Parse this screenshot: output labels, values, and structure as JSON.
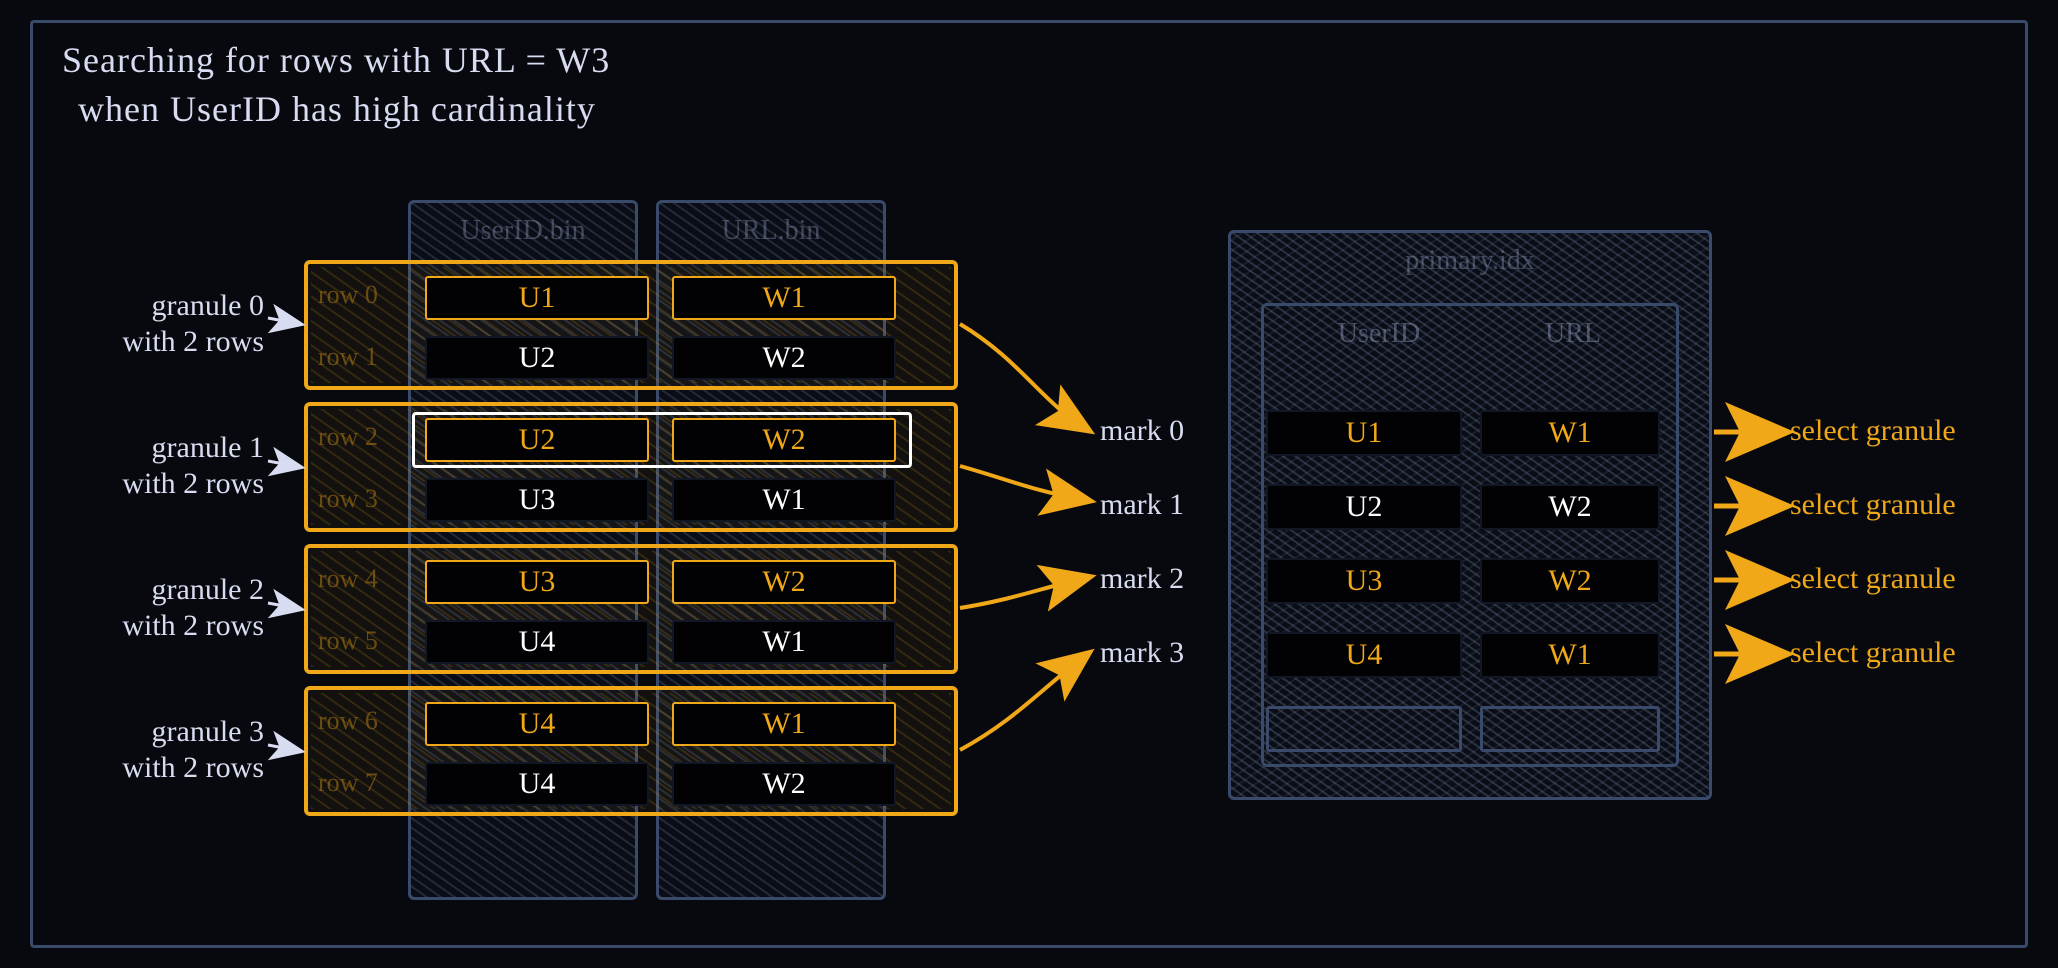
{
  "title_l1": "Searching for rows with URL = W3",
  "title_l2": "when UserID has high cardinality",
  "colfiles": {
    "userid": "UserID.bin",
    "url": "URL.bin"
  },
  "granuleLabels": [
    {
      "l1": "granule 0",
      "l2": "with 2 rows"
    },
    {
      "l1": "granule 1",
      "l2": "with 2 rows"
    },
    {
      "l1": "granule 2",
      "l2": "with 2 rows"
    },
    {
      "l1": "granule 3",
      "l2": "with 2 rows"
    }
  ],
  "rows": [
    {
      "label": "row 0",
      "u": "U1",
      "w": "W1",
      "hot": true
    },
    {
      "label": "row 1",
      "u": "U2",
      "w": "W2",
      "hot": false
    },
    {
      "label": "row 2",
      "u": "U2",
      "w": "W2",
      "hot": true
    },
    {
      "label": "row 3",
      "u": "U3",
      "w": "W1",
      "hot": false
    },
    {
      "label": "row 4",
      "u": "U3",
      "w": "W2",
      "hot": true
    },
    {
      "label": "row 5",
      "u": "U4",
      "w": "W1",
      "hot": false
    },
    {
      "label": "row 6",
      "u": "U4",
      "w": "W1",
      "hot": true
    },
    {
      "label": "row 7",
      "u": "U4",
      "w": "W2",
      "hot": false
    }
  ],
  "primary": {
    "title": "primary.idx",
    "cols": {
      "u": "UserID",
      "w": "URL"
    },
    "marks": [
      {
        "label": "mark 0",
        "u": "U1",
        "w": "W1",
        "hot": true,
        "action": "select granule"
      },
      {
        "label": "mark 1",
        "u": "U2",
        "w": "W2",
        "hot": false,
        "action": "select granule"
      },
      {
        "label": "mark 2",
        "u": "U3",
        "w": "W2",
        "hot": true,
        "action": "select granule"
      },
      {
        "label": "mark 3",
        "u": "U4",
        "w": "W1",
        "hot": true,
        "action": "select granule"
      }
    ]
  }
}
